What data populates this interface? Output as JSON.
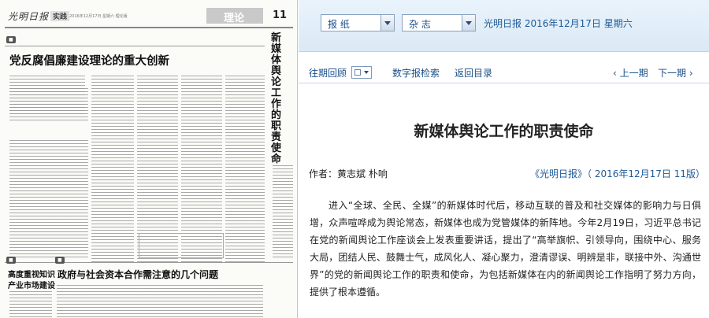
{
  "newspaper": {
    "masthead": "光明日报",
    "section_badge": "实践",
    "meta_line": "2016年12月17日 星期六 理论版",
    "section_tab": "理论",
    "page_number": "11",
    "vertical_headline": "新媒体舆论工作的职责使命",
    "headline_main": "党反腐倡廉建设理论的重大创新",
    "headline_bottom": "政府与社会资本合作需注意的几个问题",
    "headline_left_1": "高度重视知识",
    "headline_left_2": "产业市场建设"
  },
  "toolbar": {
    "edition_select": "报 纸",
    "title_select": "杂 志",
    "dateline": "光明日报 2016年12月17日 星期六"
  },
  "nav": {
    "archive": "往期回顾",
    "digital_search": "数字报检索",
    "back_to_index": "返回目录",
    "prev_issue": "上一期",
    "next_issue": "下一期"
  },
  "article": {
    "title": "新媒体舆论工作的职责使命",
    "authors": "作者：黄志斌 朴响",
    "source": "《光明日报》（ 2016年12月17日 11版）",
    "paragraph": "进入“全球、全民、全媒”的新媒体时代后，移动互联的普及和社交媒体的影响力与日俱增，众声喧哗成为舆论常态，新媒体也成为党管媒体的新阵地。今年2月19日，习近平总书记在党的新闻舆论工作座谈会上发表重要讲话，提出了“高举旗帜、引领导向，围绕中心、服务大局，团结人民、鼓舞士气，成风化人、凝心聚力，澄清谬误、明辨是非，联接中外、沟通世界”的党的新闻舆论工作的职责和使命，为包括新媒体在内的新闻舆论工作指明了努力方向，提供了根本遵循。"
  }
}
